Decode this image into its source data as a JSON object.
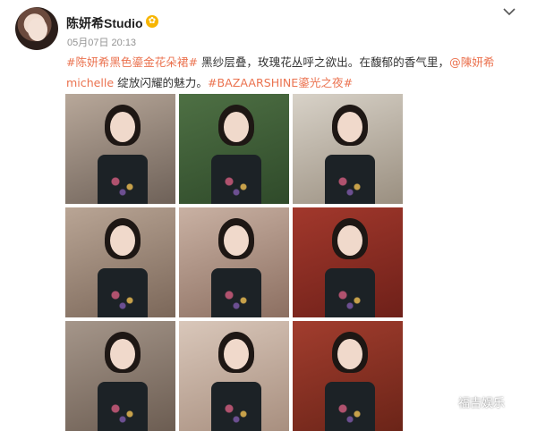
{
  "post": {
    "author": "陈妍希Studio",
    "vip_badge_glyph": "✿",
    "timestamp": "05月07日 20:13",
    "text_segments": [
      {
        "type": "tag",
        "text": "#陈妍希黑色鎏金花朵裙#"
      },
      {
        "type": "text",
        "text": " 黑纱层叠，玫瑰花丛呼之欲出。在馥郁的香气里，"
      },
      {
        "type": "mention",
        "text": "@陳妍希michelle"
      },
      {
        "type": "text",
        "text": " 绽放闪耀的魅力。"
      },
      {
        "type": "tag",
        "text": "#BAZAARSHINE鎏光之夜#"
      }
    ],
    "photos": [
      {
        "id": 1,
        "bg": "#b8a89a",
        "accent": "#6e6158"
      },
      {
        "id": 2,
        "bg": "#4e7044",
        "accent": "#2f4a2a"
      },
      {
        "id": 3,
        "bg": "#d8d2c8",
        "accent": "#9a8f80"
      },
      {
        "id": 4,
        "bg": "#b9a595",
        "accent": "#7b6759"
      },
      {
        "id": 5,
        "bg": "#c9b1a3",
        "accent": "#8c6f61"
      },
      {
        "id": 6,
        "bg": "#a2382c",
        "accent": "#6e2019"
      },
      {
        "id": 7,
        "bg": "#a5968a",
        "accent": "#6c5d52"
      },
      {
        "id": 8,
        "bg": "#d9c7ba",
        "accent": "#a88f7f"
      },
      {
        "id": 9,
        "bg": "#a23d2e",
        "accent": "#6b2418"
      }
    ]
  },
  "watermark": {
    "text": "福吉娱乐",
    "icon": "share-logo-icon"
  },
  "colors": {
    "link": "#eb7350",
    "muted": "#939393"
  }
}
